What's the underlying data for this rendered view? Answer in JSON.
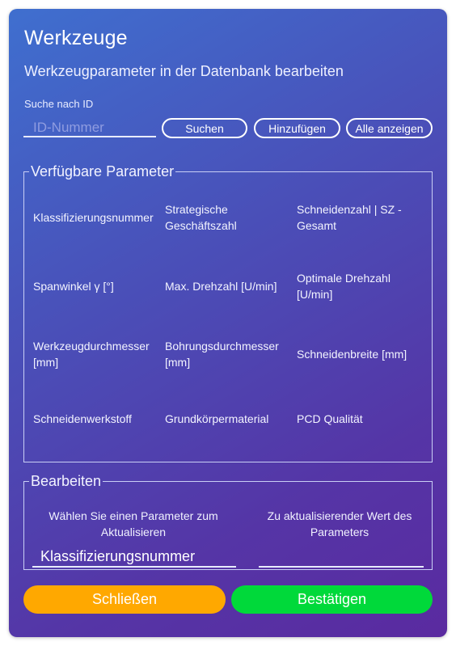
{
  "header": {
    "title": "Werkzeuge",
    "subtitle": "Werkzeugparameter in der Datenbank bearbeiten"
  },
  "search": {
    "label": "Suche nach ID",
    "placeholder": "ID-Nummer",
    "search_button": "Suchen",
    "add_button": "Hinzufügen",
    "show_all_button": "Alle anzeigen"
  },
  "parameters": {
    "legend": "Verfügbare Parameter",
    "items": [
      "Klassifizierungsnummer",
      "Strategische Geschäftszahl",
      "Schneidenzahl | SZ - Gesamt",
      "Spanwinkel γ [°]",
      "Max. Drehzahl [U/min]",
      "Optimale Drehzahl [U/min]",
      "Werkzeugdurchmesser [mm]",
      "Bohrungsdurchmesser [mm]",
      "Schneidenbreite [mm]",
      "Schneidenwerkstoff",
      "Grundkörpermaterial",
      "PCD Qualität"
    ]
  },
  "edit": {
    "legend": "Bearbeiten",
    "select_label": "Wählen Sie einen Parameter zum Aktualisieren",
    "selected_value": "Klassifizierungsnummer",
    "value_label": "Zu aktualisierender Wert des Parameters",
    "value": ""
  },
  "footer": {
    "close_button": "Schließen",
    "confirm_button": "Bestätigen"
  },
  "colors": {
    "close": "#ffa800",
    "confirm": "#00d93a",
    "gradient_start": "#3f6fcf",
    "gradient_end": "#5a2aa0"
  }
}
